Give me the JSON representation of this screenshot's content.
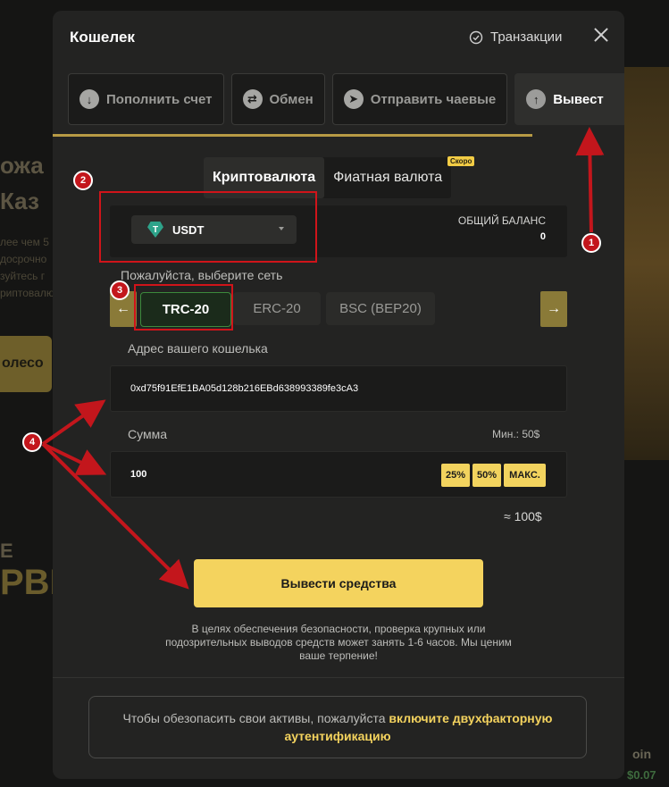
{
  "background": {
    "left_text_1": "ожа",
    "left_text_2": "Каз",
    "left_small_1": "лее чем 5",
    "left_small_2": "досрочно",
    "left_small_3": "зуйтесь г",
    "left_small_4": "риптовалю",
    "left_btn": "олесо",
    "left_big_1": "E",
    "left_big_2": "РВІ",
    "bottom_right_text": "oin",
    "bottom_right_value": "$0.07"
  },
  "modal": {
    "title": "Кошелек",
    "transactions_link": "Транзакции",
    "tabs": [
      {
        "label": "Пополнить счет",
        "icon": "arrow-down-icon"
      },
      {
        "label": "Обмен",
        "icon": "swap-icon"
      },
      {
        "label": "Отправить чаевые",
        "icon": "send-icon"
      },
      {
        "label": "Вывест",
        "icon": "arrow-up-icon"
      }
    ],
    "segment": {
      "crypto": "Криптовалюта",
      "fiat": "Фиатная валюта",
      "soon_badge": "Скоро"
    },
    "balance": {
      "coin": "USDT",
      "label": "ОБЩИЙ БАЛАНС",
      "value": "0"
    },
    "network_label": "Пожалуйста, выберите сеть",
    "networks": [
      "TRC-20",
      "ERC-20",
      "BSC (BEP20)"
    ],
    "wallet_label": "Адрес вашего кошелька",
    "wallet_value": "0xd75f91EfE1BA05d128b216EBd638993389fe3cA3",
    "amount_label": "Сумма",
    "amount_min": "Мин.: 50$",
    "amount_value": "100",
    "pct_buttons": [
      "25%",
      "50%",
      "МАКС."
    ],
    "approx": "≈ 100$",
    "cta": "Вывести средства",
    "note": "В целях обеспечения безопасности, проверка крупных или подозрительных выводов средств может занять 1-6 часов. Мы ценим ваше терпение!",
    "twofa_text": "Чтобы обезопасить свои активы, пожалуйста ",
    "twofa_link": "включите двухфакторную аутентификацию"
  },
  "annotations": [
    "1",
    "2",
    "3",
    "4"
  ],
  "colors": {
    "accent": "#f4d35e",
    "annotation": "#d0141a",
    "underline": "#b79a45"
  }
}
